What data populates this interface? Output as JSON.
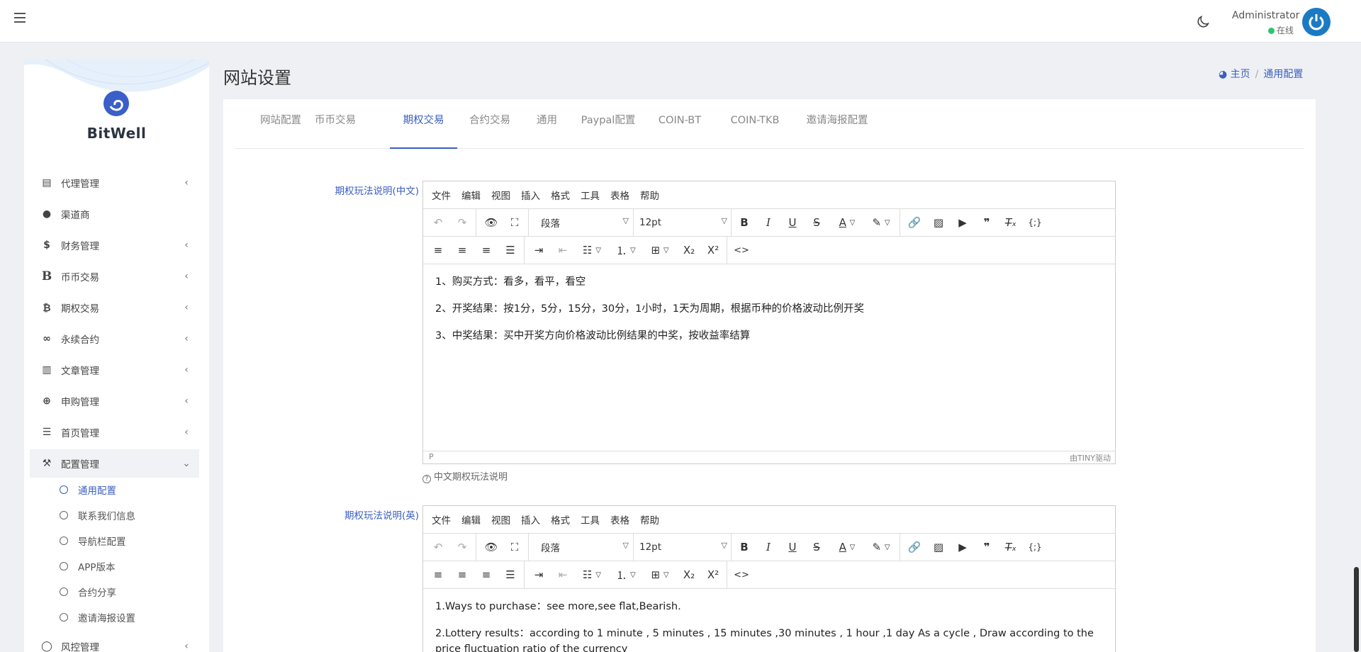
{
  "header": {
    "user_name": "Administrator",
    "user_status": "在线"
  },
  "sidebar": {
    "brand": "BitWell",
    "items": [
      {
        "label": "代理管理",
        "icon": "id-card-icon"
      },
      {
        "label": "渠道商",
        "icon": "user-circle-icon"
      },
      {
        "label": "财务管理",
        "icon": "dollar-icon"
      },
      {
        "label": "币币交易",
        "icon": "bold-b-icon"
      },
      {
        "label": "期权交易",
        "icon": "bitcoin-icon"
      },
      {
        "label": "永续合约",
        "icon": "link-icon"
      },
      {
        "label": "文章管理",
        "icon": "newspaper-icon"
      },
      {
        "label": "申购管理",
        "icon": "lifebuoy-icon"
      },
      {
        "label": "首页管理",
        "icon": "bars-icon"
      },
      {
        "label": "配置管理",
        "icon": "wrench-icon"
      },
      {
        "label": "风控管理",
        "icon": "shield-icon"
      }
    ],
    "subitems": [
      "通用配置",
      "联系我们信息",
      "导航栏配置",
      "APP版本",
      "合约分享",
      "邀请海报设置"
    ]
  },
  "page": {
    "title": "网站设置",
    "breadcrumb_home": "主页",
    "breadcrumb_current": "通用配置"
  },
  "tabs": [
    "网站配置",
    "币币交易",
    "期权交易",
    "合约交易",
    "通用",
    "Paypal配置",
    "COIN-BT",
    "COIN-TKB",
    "邀请海报配置"
  ],
  "active_tab": "期权交易",
  "editor_common": {
    "menu": [
      "文件",
      "编辑",
      "视图",
      "插入",
      "格式",
      "工具",
      "表格",
      "帮助"
    ],
    "block_format": "段落",
    "font_size": "12pt",
    "status_path": "P",
    "powered_by": "由TINY驱动"
  },
  "editor_cn": {
    "label": "期权玩法说明(中文)",
    "paragraphs": [
      "1、购买方式：看多，看平，看空",
      "2、开奖结果：按1分，5分，15分，30分，1小时，1天为周期，根据币种的价格波动比例开奖",
      "3、中奖结果：买中开奖方向价格波动比例结果的中奖，按收益率结算"
    ],
    "help": "中文期权玩法说明"
  },
  "editor_en": {
    "label": "期权玩法说明(英)",
    "paragraphs": [
      "1.Ways to purchase：see more,see flat,Bearish.",
      "2.Lottery results：according to 1 minute , 5 minutes , 15 minutes ,30 minutes , 1 hour ,1 day As a cycle , Draw according to the price fluctuation ratio of the currency"
    ]
  }
}
